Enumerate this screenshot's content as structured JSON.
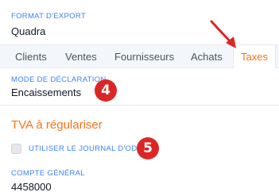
{
  "export": {
    "label": "FORMAT D'EXPORT",
    "value": "Quadra"
  },
  "tabs": [
    {
      "label": "Clients"
    },
    {
      "label": "Ventes"
    },
    {
      "label": "Fournisseurs"
    },
    {
      "label": "Achats"
    },
    {
      "label": "Taxes"
    }
  ],
  "active_tab": "Taxes",
  "declaration": {
    "label": "MODE DE DÉCLARATION",
    "value": "Encaissements"
  },
  "tva": {
    "title": "TVA à régulariser"
  },
  "journal_checkbox": {
    "label": "UTILISER LE JOURNAL D'OD",
    "checked": false
  },
  "compte": {
    "label": "COMPTE GÉNÉRAL",
    "value": "4458000"
  },
  "annotations": {
    "badge_4": "4",
    "badge_5": "5",
    "arrow_icon": "red-arrow-icon"
  },
  "colors": {
    "accent": "#f97316",
    "label_blue": "#3b82f6",
    "badge_red": "#dc2626"
  }
}
